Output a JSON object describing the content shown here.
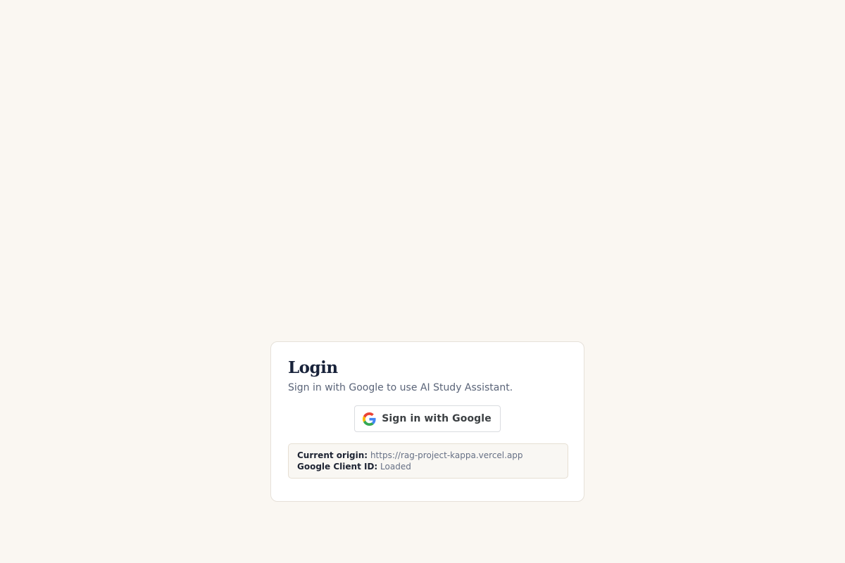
{
  "login": {
    "title": "Login",
    "subtitle": "Sign in with Google to use AI Study Assistant.",
    "google_button_label": "Sign in with Google"
  },
  "info": {
    "origin_label": "Current origin:",
    "origin_value": "https://rag-project-kappa.vercel.app",
    "client_id_label": "Google Client ID:",
    "client_id_value": "Loaded"
  },
  "icons": {
    "google": "google-g-icon"
  },
  "colors": {
    "background": "#faf7f2",
    "card": "#ffffff",
    "title": "#18223a",
    "subtitle": "#5a6478",
    "google_blue": "#4285F4",
    "google_red": "#EA4335",
    "google_yellow": "#FBBC05",
    "google_green": "#34A853"
  }
}
